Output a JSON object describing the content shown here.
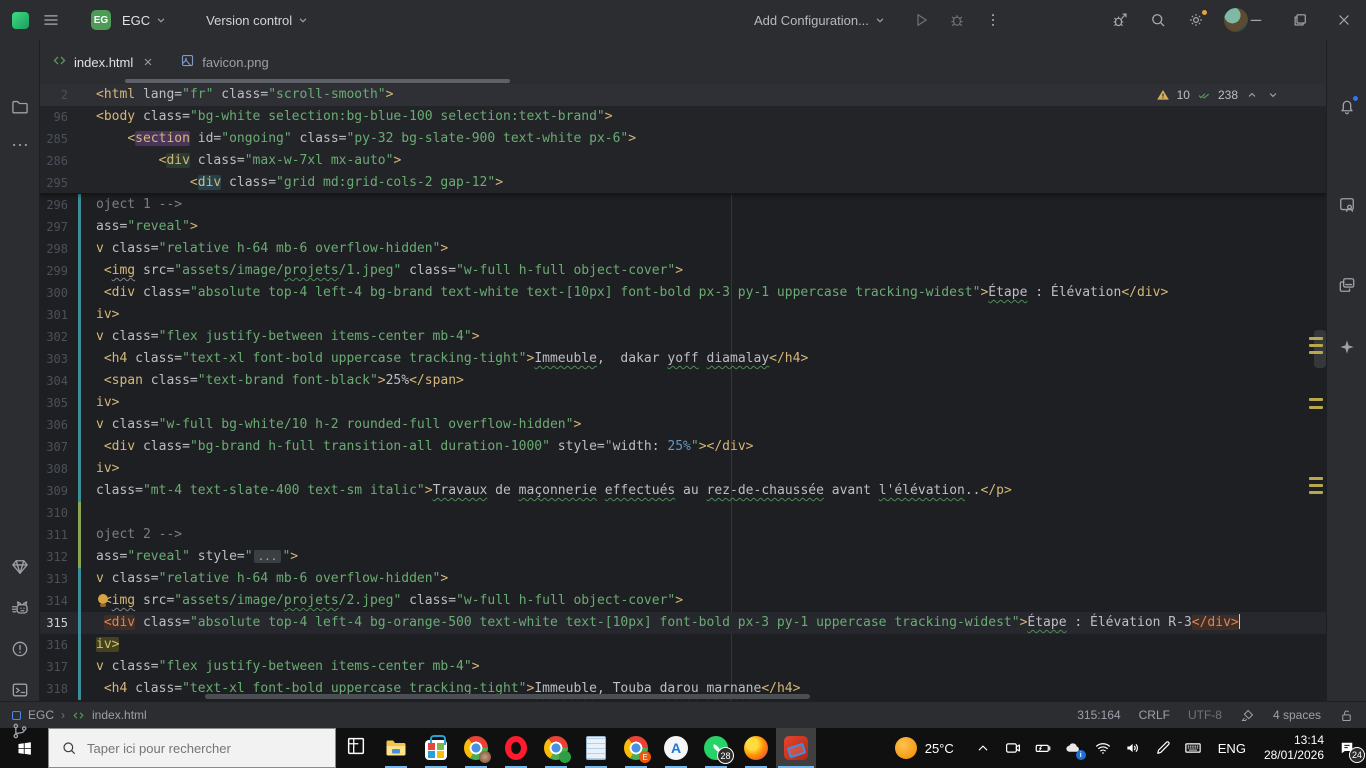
{
  "titlebar": {
    "project_badge": "EG",
    "project_name": "EGC",
    "vcs_label": "Version control",
    "run_config": "Add Configuration...",
    "left_icons": [
      "app-logo",
      "main-menu-icon"
    ],
    "run_icons": [
      "run-icon",
      "debug-icon",
      "more-vertical-icon"
    ],
    "right_icons": [
      "profiler-icon",
      "search-icon",
      "settings-icon",
      "avatar"
    ],
    "window_controls": [
      "minimize-icon",
      "maximize-icon",
      "close-icon"
    ]
  },
  "tabs": [
    {
      "label": "index.html",
      "icon": "html-file-icon",
      "active": true,
      "closable": true
    },
    {
      "label": "favicon.png",
      "icon": "image-file-icon",
      "active": false,
      "closable": false
    }
  ],
  "inspections": {
    "warnings": "10",
    "typos": "238"
  },
  "left_strip": {
    "top": [
      "folder-icon",
      "more-icon"
    ],
    "bottom": [
      "gem-icon",
      "cat-icon",
      "problems-icon",
      "terminal-icon",
      "git-branch-icon"
    ]
  },
  "right_strip": {
    "items": [
      "bell-icon",
      "device-preview-icon",
      "layers-icon",
      "ai-sparkle-icon"
    ]
  },
  "colors": {
    "modified_line_teal": "#3a8f98",
    "added_line_green": "#8aa653",
    "warning_yellow": "#d6ae58",
    "typo_check_green": "#57965c",
    "notification_blue": "#3574f0",
    "taskbar_underline_blue": "#76b9ed",
    "project_badge_green": "#4d9b57"
  },
  "editor": {
    "sticky_lines": [
      {
        "n": "2",
        "tk": [
          [
            "t",
            "<html"
          ],
          [
            "p",
            " lang="
          ],
          [
            "s",
            "\"fr\""
          ],
          [
            "p",
            " class="
          ],
          [
            "s",
            "\"scroll-smooth\""
          ],
          [
            "t",
            ">"
          ]
        ]
      },
      {
        "n": "96",
        "tk": [
          [
            "t",
            "<body"
          ],
          [
            "p",
            " class="
          ],
          [
            "s",
            "\"bg-white selection:bg-blue-100 selection:text-brand\""
          ],
          [
            "t",
            ">"
          ]
        ]
      },
      {
        "n": "285",
        "tk": [
          [
            "p",
            "    "
          ],
          [
            "t",
            "<"
          ],
          [
            "t hlp",
            "section"
          ],
          [
            "p",
            " id="
          ],
          [
            "s",
            "\"ongoing\""
          ],
          [
            "p",
            " class="
          ],
          [
            "s",
            "\"py-32 bg-slate-900 text-white px-6\""
          ],
          [
            "t",
            ">"
          ]
        ]
      },
      {
        "n": "286",
        "tk": [
          [
            "p",
            "        "
          ],
          [
            "t",
            "<"
          ],
          [
            "t hlg",
            "div"
          ],
          [
            "p",
            " class="
          ],
          [
            "s",
            "\"max-w-7xl mx-auto\""
          ],
          [
            "t",
            ">"
          ]
        ]
      },
      {
        "n": "295",
        "tk": [
          [
            "p",
            "            "
          ],
          [
            "t",
            "<"
          ],
          [
            "t hlt",
            "div"
          ],
          [
            "p",
            " class="
          ],
          [
            "s",
            "\"grid md:grid-cols-2 gap-12\""
          ],
          [
            "t",
            ">"
          ]
        ]
      }
    ],
    "lines": [
      {
        "n": "296",
        "g": "teal",
        "tk": [
          [
            "c",
            "oject 1 -->"
          ]
        ]
      },
      {
        "n": "297",
        "g": "teal",
        "tk": [
          [
            "p",
            "ass="
          ],
          [
            "s",
            "\"reveal\""
          ],
          [
            "t",
            ">"
          ]
        ]
      },
      {
        "n": "298",
        "g": "teal",
        "tk": [
          [
            "t",
            "v"
          ],
          [
            "p",
            " class="
          ],
          [
            "s",
            "\"relative h-64 mb-6 overflow-hidden\""
          ],
          [
            "t",
            ">"
          ]
        ]
      },
      {
        "n": "299",
        "g": "teal",
        "tk": [
          [
            "p",
            " "
          ],
          [
            "t",
            "<"
          ],
          [
            "t sqg",
            "img"
          ],
          [
            "p",
            " src="
          ],
          [
            "s",
            "\"assets/image/"
          ],
          [
            "s sq",
            "projets"
          ],
          [
            "s",
            "/1.jpeg\""
          ],
          [
            "p",
            " class="
          ],
          [
            "s",
            "\"w-full h-full object-cover\""
          ],
          [
            "t",
            ">"
          ]
        ]
      },
      {
        "n": "300",
        "g": "teal",
        "tk": [
          [
            "p",
            " "
          ],
          [
            "t",
            "<div"
          ],
          [
            "p",
            " class="
          ],
          [
            "s",
            "\"absolute top-4 left-4 bg-brand text-white text-[10px] font-bold px-3 py-1 uppercase tracking-widest\""
          ],
          [
            "t",
            ">"
          ],
          [
            "p sq",
            "Étape"
          ],
          [
            "p",
            " : Élévation"
          ],
          [
            "t",
            "</div>"
          ]
        ]
      },
      {
        "n": "301",
        "g": "teal",
        "tk": [
          [
            "t",
            "iv>"
          ]
        ]
      },
      {
        "n": "302",
        "g": "teal",
        "tk": [
          [
            "t",
            "v"
          ],
          [
            "p",
            " class="
          ],
          [
            "s",
            "\"flex justify-between items-center mb-4\""
          ],
          [
            "t",
            ">"
          ]
        ]
      },
      {
        "n": "303",
        "g": "teal",
        "tk": [
          [
            "p",
            " "
          ],
          [
            "t",
            "<h4"
          ],
          [
            "p",
            " class="
          ],
          [
            "s",
            "\"text-xl font-bold uppercase tracking-tight\""
          ],
          [
            "t",
            ">"
          ],
          [
            "p sq",
            "Immeuble"
          ],
          [
            "p",
            ",  dakar "
          ],
          [
            "p sq",
            "yoff"
          ],
          [
            "p",
            " "
          ],
          [
            "p sq",
            "diamalay"
          ],
          [
            "t",
            "</h4>"
          ]
        ]
      },
      {
        "n": "304",
        "g": "teal",
        "tk": [
          [
            "p",
            " "
          ],
          [
            "t",
            "<span"
          ],
          [
            "p",
            " class="
          ],
          [
            "s",
            "\"text-brand font-black\""
          ],
          [
            "t",
            ">"
          ],
          [
            "p",
            "25%"
          ],
          [
            "t",
            "</span>"
          ]
        ]
      },
      {
        "n": "305",
        "g": "teal",
        "tk": [
          [
            "t",
            "iv>"
          ]
        ]
      },
      {
        "n": "306",
        "g": "teal",
        "tk": [
          [
            "t",
            "v"
          ],
          [
            "p",
            " class="
          ],
          [
            "s",
            "\"w-full bg-white/10 h-2 rounded-full overflow-hidden\""
          ],
          [
            "t",
            ">"
          ]
        ]
      },
      {
        "n": "307",
        "g": "teal",
        "tk": [
          [
            "p",
            " "
          ],
          [
            "t",
            "<div"
          ],
          [
            "p",
            " class="
          ],
          [
            "s",
            "\"bg-brand h-full transition-all duration-1000\""
          ],
          [
            "p",
            " style="
          ],
          [
            "s",
            "\""
          ],
          [
            "p",
            "width: "
          ],
          [
            "n",
            "25%"
          ],
          [
            "s",
            "\""
          ],
          [
            "t",
            ">"
          ],
          [
            "t",
            "</div>"
          ]
        ]
      },
      {
        "n": "308",
        "g": "teal",
        "tk": [
          [
            "t",
            "iv>"
          ]
        ]
      },
      {
        "n": "309",
        "g": "teal",
        "tk": [
          [
            "p",
            "class="
          ],
          [
            "s",
            "\"mt-4 text-slate-400 text-sm italic\""
          ],
          [
            "t",
            ">"
          ],
          [
            "p sq",
            "Travaux"
          ],
          [
            "p",
            " de "
          ],
          [
            "p sq",
            "maçonnerie"
          ],
          [
            "p",
            " "
          ],
          [
            "p sq",
            "effectués"
          ],
          [
            "p",
            " au "
          ],
          [
            "p sq",
            "rez-de-chaussée"
          ],
          [
            "p",
            " avant "
          ],
          [
            "p sq",
            "l'élévation"
          ],
          [
            "p",
            ".."
          ],
          [
            "t",
            "</p>"
          ]
        ]
      },
      {
        "n": "310",
        "g": "green",
        "tk": []
      },
      {
        "n": "311",
        "g": "green",
        "tk": [
          [
            "c",
            "oject 2 -->"
          ]
        ]
      },
      {
        "n": "312",
        "g": "green",
        "tk": [
          [
            "p",
            "ass="
          ],
          [
            "s",
            "\"reveal\""
          ],
          [
            "p",
            " style="
          ],
          [
            "s",
            "\""
          ],
          [
            "f",
            "..."
          ],
          [
            "s",
            "\""
          ],
          [
            "t",
            ">"
          ]
        ]
      },
      {
        "n": "313",
        "g": "teal",
        "tk": [
          [
            "t",
            "v"
          ],
          [
            "p",
            " class="
          ],
          [
            "s",
            "\"relative h-64 mb-6 overflow-hidden\""
          ],
          [
            "t",
            ">"
          ]
        ]
      },
      {
        "n": "314",
        "g": "teal",
        "bulb": true,
        "tk": [
          [
            "p",
            " "
          ],
          [
            "t",
            "<"
          ],
          [
            "t sqg",
            "img"
          ],
          [
            "p",
            " src="
          ],
          [
            "s",
            "\"assets/image/"
          ],
          [
            "s sq",
            "projets"
          ],
          [
            "s",
            "/2.jpeg\""
          ],
          [
            "p",
            " class="
          ],
          [
            "s",
            "\"w-full h-full object-cover\""
          ],
          [
            "t",
            ">"
          ]
        ]
      },
      {
        "n": "315",
        "g": "teal",
        "cur": true,
        "caret": true,
        "tk": [
          [
            "p",
            " "
          ],
          [
            "mt",
            "<div"
          ],
          [
            "p",
            " class="
          ],
          [
            "s",
            "\"absolute top-4 left-4 bg-orange-500 text-white text-[10px] font-bold px-3 py-1 uppercase tracking-widest\""
          ],
          [
            "t",
            ">"
          ],
          [
            "p sq",
            "Étape"
          ],
          [
            "p",
            " : Élévation R-3"
          ],
          [
            "mt",
            "</div>"
          ]
        ]
      },
      {
        "n": "316",
        "g": "teal",
        "tk": [
          [
            "mty",
            "iv>"
          ]
        ]
      },
      {
        "n": "317",
        "g": "teal",
        "tk": [
          [
            "t",
            "v"
          ],
          [
            "p",
            " class="
          ],
          [
            "s",
            "\"flex justify-between items-center mb-4\""
          ],
          [
            "t",
            ">"
          ]
        ]
      },
      {
        "n": "318",
        "g": "teal",
        "tk": [
          [
            "p",
            " "
          ],
          [
            "t",
            "<h4"
          ],
          [
            "p",
            " class="
          ],
          [
            "s",
            "\"text-xl font-bold uppercase tracking-tight\""
          ],
          [
            "t",
            ">"
          ],
          [
            "p sq",
            "Immeuble"
          ],
          [
            "p",
            ", Touba "
          ],
          [
            "p sq",
            "darou"
          ],
          [
            "p",
            " "
          ],
          [
            "p sq",
            "marnane"
          ],
          [
            "t",
            "</h4>"
          ]
        ]
      }
    ],
    "stripe_marks_y": [
      253,
      260,
      267,
      314,
      322,
      393,
      400,
      407
    ]
  },
  "statusbar": {
    "breadcrumb_project": "EGC",
    "breadcrumb_file": "index.html",
    "caret": "315:164",
    "line_ending": "CRLF",
    "encoding": "UTF-8",
    "indent": "4 spaces",
    "icons": [
      "highlighting-level-icon",
      "unlock-icon"
    ]
  },
  "taskbar": {
    "search_placeholder": "Taper ici pour rechercher",
    "apps": [
      {
        "name": "task-view",
        "kind": "taskview",
        "running": false
      },
      {
        "name": "file-explorer",
        "kind": "explorer",
        "running": true
      },
      {
        "name": "microsoft-store",
        "kind": "store",
        "running": true
      },
      {
        "name": "chrome-profile-1",
        "kind": "chrome",
        "running": true,
        "badge": "avatar"
      },
      {
        "name": "opera",
        "kind": "opera",
        "running": true
      },
      {
        "name": "chrome-profile-2",
        "kind": "chrome",
        "running": true,
        "badge": "green"
      },
      {
        "name": "notepad",
        "kind": "notepad",
        "running": true
      },
      {
        "name": "chrome-profile-3",
        "kind": "chrome",
        "running": true,
        "badge": "orangeE"
      },
      {
        "name": "app-circle-a",
        "kind": "circleA",
        "running": true,
        "label": "A"
      },
      {
        "name": "whatsapp",
        "kind": "whatsapp",
        "running": true,
        "badge_text": "28"
      },
      {
        "name": "firefox",
        "kind": "firefox",
        "running": true
      },
      {
        "name": "snipping-tool",
        "kind": "snip",
        "running": true,
        "active": true
      }
    ],
    "tray": {
      "temp": "25°C",
      "lang": "ENG",
      "time": "13:14",
      "date": "28/01/2026",
      "notif_badge": "24",
      "icons": [
        "weather",
        "hidden-icons-chevron",
        "meet-now-camera",
        "battery",
        "onedrive-cloud",
        "wifi",
        "volume",
        "windows-ink-pen",
        "touch-keyboard",
        "language",
        "clock",
        "notifications"
      ]
    }
  }
}
